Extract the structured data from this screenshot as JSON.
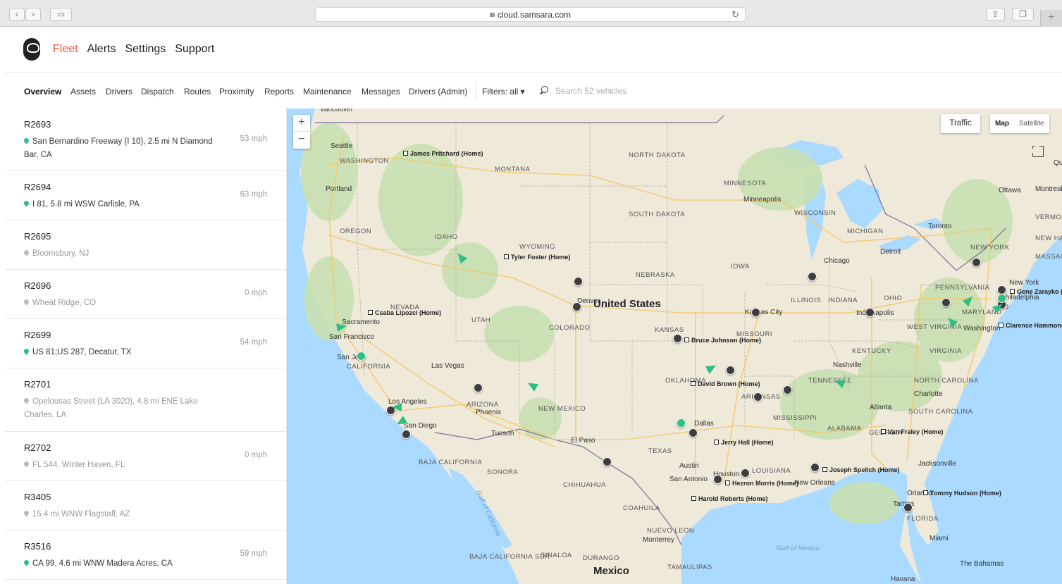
{
  "browser": {
    "url": "cloud.samsara.com"
  },
  "header": {
    "nav": [
      "Fleet",
      "Alerts",
      "Settings",
      "Support"
    ],
    "active": "Fleet"
  },
  "subnav": {
    "items": [
      "Overview",
      "Assets",
      "Drivers",
      "Dispatch",
      "Routes",
      "Proximity",
      "Reports",
      "Maintenance",
      "Messages",
      "Drivers (Admin)"
    ],
    "filters_label": "Filters: all ▾",
    "search_placeholder": "Search 52 vehicles"
  },
  "vehicles": [
    {
      "name": "R2693",
      "location": "San Bernardino Freeway (I 10), 2.5 mi N Diamond Bar, CA",
      "speed": "53 mph",
      "active": true
    },
    {
      "name": "R2694",
      "location": "I 81, 5.8 mi WSW Carlisle, PA",
      "speed": "63 mph",
      "active": true
    },
    {
      "name": "R2695",
      "location": "Bloomsbury, NJ",
      "speed": "",
      "active": false
    },
    {
      "name": "R2696",
      "location": "Wheat Ridge, CO",
      "speed": "0 mph",
      "active": false
    },
    {
      "name": "R2699",
      "location": "US 81;US 287, Decatur, TX",
      "speed": "54 mph",
      "active": true
    },
    {
      "name": "R2701",
      "location": "Opelousas Street (LA 3020), 4.8 mi ENE Lake Charles, LA",
      "speed": "",
      "active": false
    },
    {
      "name": "R2702",
      "location": "FL 544, Winter Haven, FL",
      "speed": "0 mph",
      "active": false
    },
    {
      "name": "R3405",
      "location": "15.4 mi WNW Flagstaff, AZ",
      "speed": "",
      "active": false
    },
    {
      "name": "R3516",
      "location": "CA 99, 4.6 mi WNW Madera Acres, CA",
      "speed": "59 mph",
      "active": true
    }
  ],
  "map": {
    "traffic_label": "Traffic",
    "map_label": "Map",
    "satellite_label": "Satellite",
    "zoom_in": "+",
    "zoom_out": "−",
    "country_label": "United States",
    "mexico_label": "Mexico",
    "states": [
      "WASHINGTON",
      "MONTANA",
      "NORTH DAKOTA",
      "MINNESOTA",
      "OREGON",
      "IDAHO",
      "SOUTH DAKOTA",
      "WYOMING",
      "WISCONSIN",
      "MICHIGAN",
      "IOWA",
      "NEBRASKA",
      "NEVADA",
      "UTAH",
      "COLORADO",
      "ILLINOIS",
      "INDIANA",
      "OHIO",
      "PENNSYLVANIA",
      "KANSAS",
      "MISSOURI",
      "KENTUCKY",
      "WEST VIRGINIA",
      "VIRGINIA",
      "CALIFORNIA",
      "ARIZONA",
      "NEW MEXICO",
      "OKLAHOMA",
      "ARKANSAS",
      "TENNESSEE",
      "NORTH CAROLINA",
      "SOUTH CAROLINA",
      "MISSISSIPPI",
      "ALABAMA",
      "GEORGIA",
      "TEXAS",
      "LOUISIANA",
      "FLORIDA",
      "MARYLAND",
      "NJ",
      "NEW YORK",
      "VERMONT",
      "NEW HAMPS",
      "MASSACH",
      "BAJA CALIFORNIA",
      "SONORA",
      "CHIHUAHUA",
      "COAHUILA",
      "NUEVO LEON",
      "BAJA CALIFORNIA SUR",
      "SINALOA",
      "DURANGO",
      "TAMAULIPAS"
    ],
    "cities": [
      "Vancouver",
      "Seattle",
      "Portland",
      "Sacramento",
      "San Francisco",
      "San Jose",
      "Las Vegas",
      "Los Angeles",
      "San Diego",
      "Phoenix",
      "Tucson",
      "El Paso",
      "Denver",
      "Minneapolis",
      "Chicago",
      "Detroit",
      "Toronto",
      "Ottawa",
      "Montreal",
      "Québ",
      "Kansas City",
      "Indianapolis",
      "Nashville",
      "Charlotte",
      "Atlanta",
      "Dallas",
      "Austin",
      "San Antonio",
      "Houston",
      "New Orleans",
      "Jacksonville",
      "Orlando",
      "Tampa",
      "Miami",
      "Monterrey",
      "Havana",
      "The Bahamas",
      "Washington",
      "New York",
      "Philadelphia"
    ],
    "homes": [
      "James Pritchard (Home)",
      "Tyler Foster (Home)",
      "Csaba Lipozci (Home)",
      "Bruce Johnson (Home)",
      "David Brown (Home)",
      "Jerry Hall (Home)",
      "Hezron Morris (Home)",
      "Harold Roberts (Home)",
      "Joseph Spelich (Home)",
      "Van Fraley (Home)",
      "Tommy Hudson (Home)",
      "Clarence Hammond (Home)",
      "Gene Zarayko (Home)"
    ],
    "water": [
      "Gulf of California",
      "Gulf of Mexico"
    ]
  }
}
